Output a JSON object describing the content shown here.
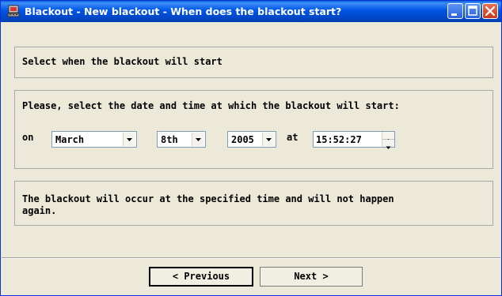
{
  "window": {
    "title": "Blackout - New blackout - When does the blackout start?",
    "titlebar_color": "#0055e5",
    "buttons": [
      "minimize-icon",
      "maximize-icon",
      "close-icon"
    ]
  },
  "header": {
    "text": "Select when the blackout will start"
  },
  "date_section": {
    "prompt": "Please, select the date and time at which the blackout will start:",
    "on_label": "on",
    "month": "March",
    "day": "8th",
    "year": "2005",
    "at_label": "at",
    "time": "15:52:27"
  },
  "info": {
    "line1": "The blackout will occur at the specified time and will not happen",
    "line2": "again."
  },
  "footer": {
    "previous_label": "< Previous",
    "next_label": "Next >"
  }
}
